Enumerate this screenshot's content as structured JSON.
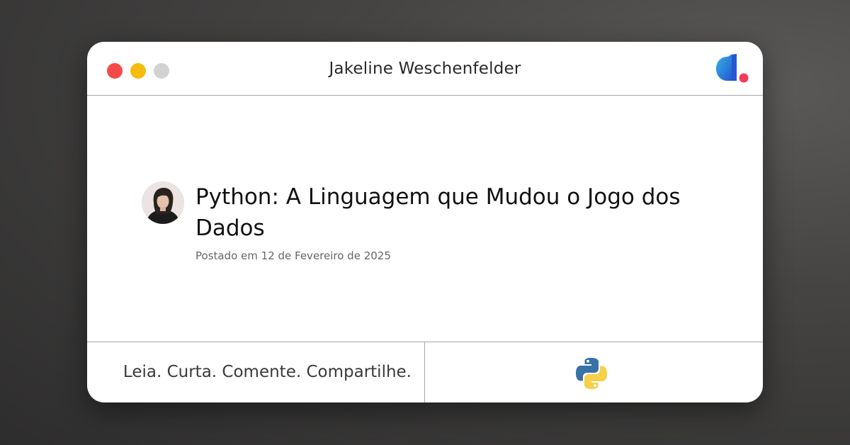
{
  "window": {
    "title": "Jakeline Weschenfelder",
    "controls": [
      "close",
      "minimize",
      "zoom"
    ],
    "logo_icon": "dio-logo-icon"
  },
  "post": {
    "title": "Python: A Linguagem que Mudou o Jogo dos Dados",
    "date": "Postado em 12 de Fevereiro de 2025",
    "avatar_icon": "author-avatar"
  },
  "footer": {
    "tagline": "Leia. Curta. Comente. Compartilhe.",
    "tech_icon": "python-logo-icon"
  },
  "colors": {
    "close": "#f44a4a",
    "minimize": "#f5bb0f",
    "zoom": "#d2d2d2",
    "python_blue": "#3872a6",
    "python_yellow": "#f7d04a",
    "logo_pink": "#f33c5b",
    "logo_blue": "#2f7fd8"
  }
}
